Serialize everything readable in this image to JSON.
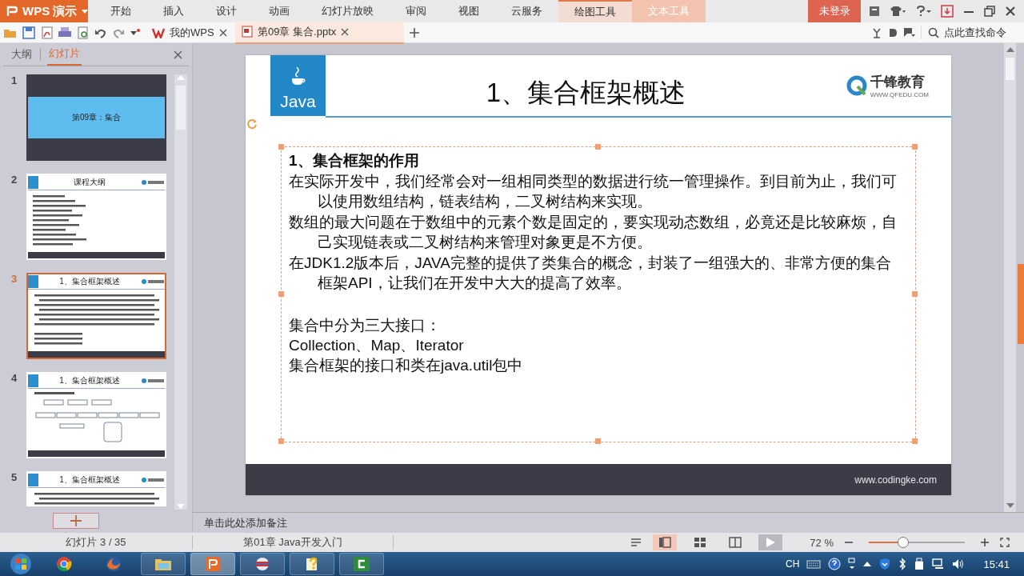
{
  "app_menu": {
    "label": "WPS 演示"
  },
  "ribbon_tabs": [
    {
      "label": "开始",
      "selected": false,
      "kind": "normal"
    },
    {
      "label": "插入",
      "selected": false,
      "kind": "normal"
    },
    {
      "label": "设计",
      "selected": false,
      "kind": "normal"
    },
    {
      "label": "动画",
      "selected": false,
      "kind": "normal"
    },
    {
      "label": "幻灯片放映",
      "selected": false,
      "kind": "normal"
    },
    {
      "label": "审阅",
      "selected": false,
      "kind": "normal"
    },
    {
      "label": "视图",
      "selected": false,
      "kind": "normal"
    },
    {
      "label": "云服务",
      "selected": false,
      "kind": "normal"
    },
    {
      "label": "绘图工具",
      "selected": true,
      "kind": "context"
    },
    {
      "label": "文本工具",
      "selected": false,
      "kind": "context"
    }
  ],
  "login_button": "未登录",
  "doc_tabs": [
    {
      "label": "我的WPS",
      "selected": false,
      "kind": "home"
    },
    {
      "label": "第09章 集合.pptx",
      "selected": true,
      "kind": "file"
    }
  ],
  "command_search": {
    "placeholder": "点此查找命令"
  },
  "panel_tabs": [
    {
      "label": "大纲",
      "selected": false
    },
    {
      "label": "幻灯片",
      "selected": true
    }
  ],
  "thumbnails": [
    {
      "number": "1",
      "title": "第09章：集合",
      "kind": "cover",
      "selected": false
    },
    {
      "number": "2",
      "title": "课程大纲",
      "kind": "list",
      "selected": false
    },
    {
      "number": "3",
      "title": "1、集合框架概述",
      "kind": "text",
      "selected": true
    },
    {
      "number": "4",
      "title": "1、集合框架概述",
      "kind": "diagram",
      "selected": false
    },
    {
      "number": "5",
      "title": "1、集合框架概述",
      "kind": "text",
      "selected": false
    }
  ],
  "slide": {
    "badge": "Java",
    "title": "1、集合框架概述",
    "brand": "千锋教育",
    "brand_url": "WWW.QFEDU.COM",
    "heading": "1、集合框架的作用",
    "paragraphs": [
      "在实际开发中，我们经常会对一组相同类型的数据进行统一管理操作。到目前为止，我们可以使用数组结构，链表结构，二叉树结构来实现。",
      "数组的最大问题在于数组中的元素个数是固定的，要实现动态数组，必竟还是比较麻烦，自己实现链表或二叉树结构来管理对象更是不方便。",
      "在JDK1.2版本后，JAVA完整的提供了类集合的概念，封装了一组强大的、非常方便的集合框架API，让我们在开发中大大的提高了效率。"
    ],
    "lines": [
      "集合中分为三大接口：",
      "Collection、Map、Iterator",
      "集合框架的接口和类在java.util包中"
    ],
    "footer_url": "www.codingke.com"
  },
  "notes": {
    "placeholder": "单击此处添加备注"
  },
  "status_bar": {
    "slide_count": "幻灯片 3 / 35",
    "template": "第01章 Java开发入门",
    "zoom": "72 %",
    "zoom_slider": {
      "level": 0.36
    }
  },
  "taskbar": {
    "input_method": "CH",
    "clock": "15:41"
  }
}
